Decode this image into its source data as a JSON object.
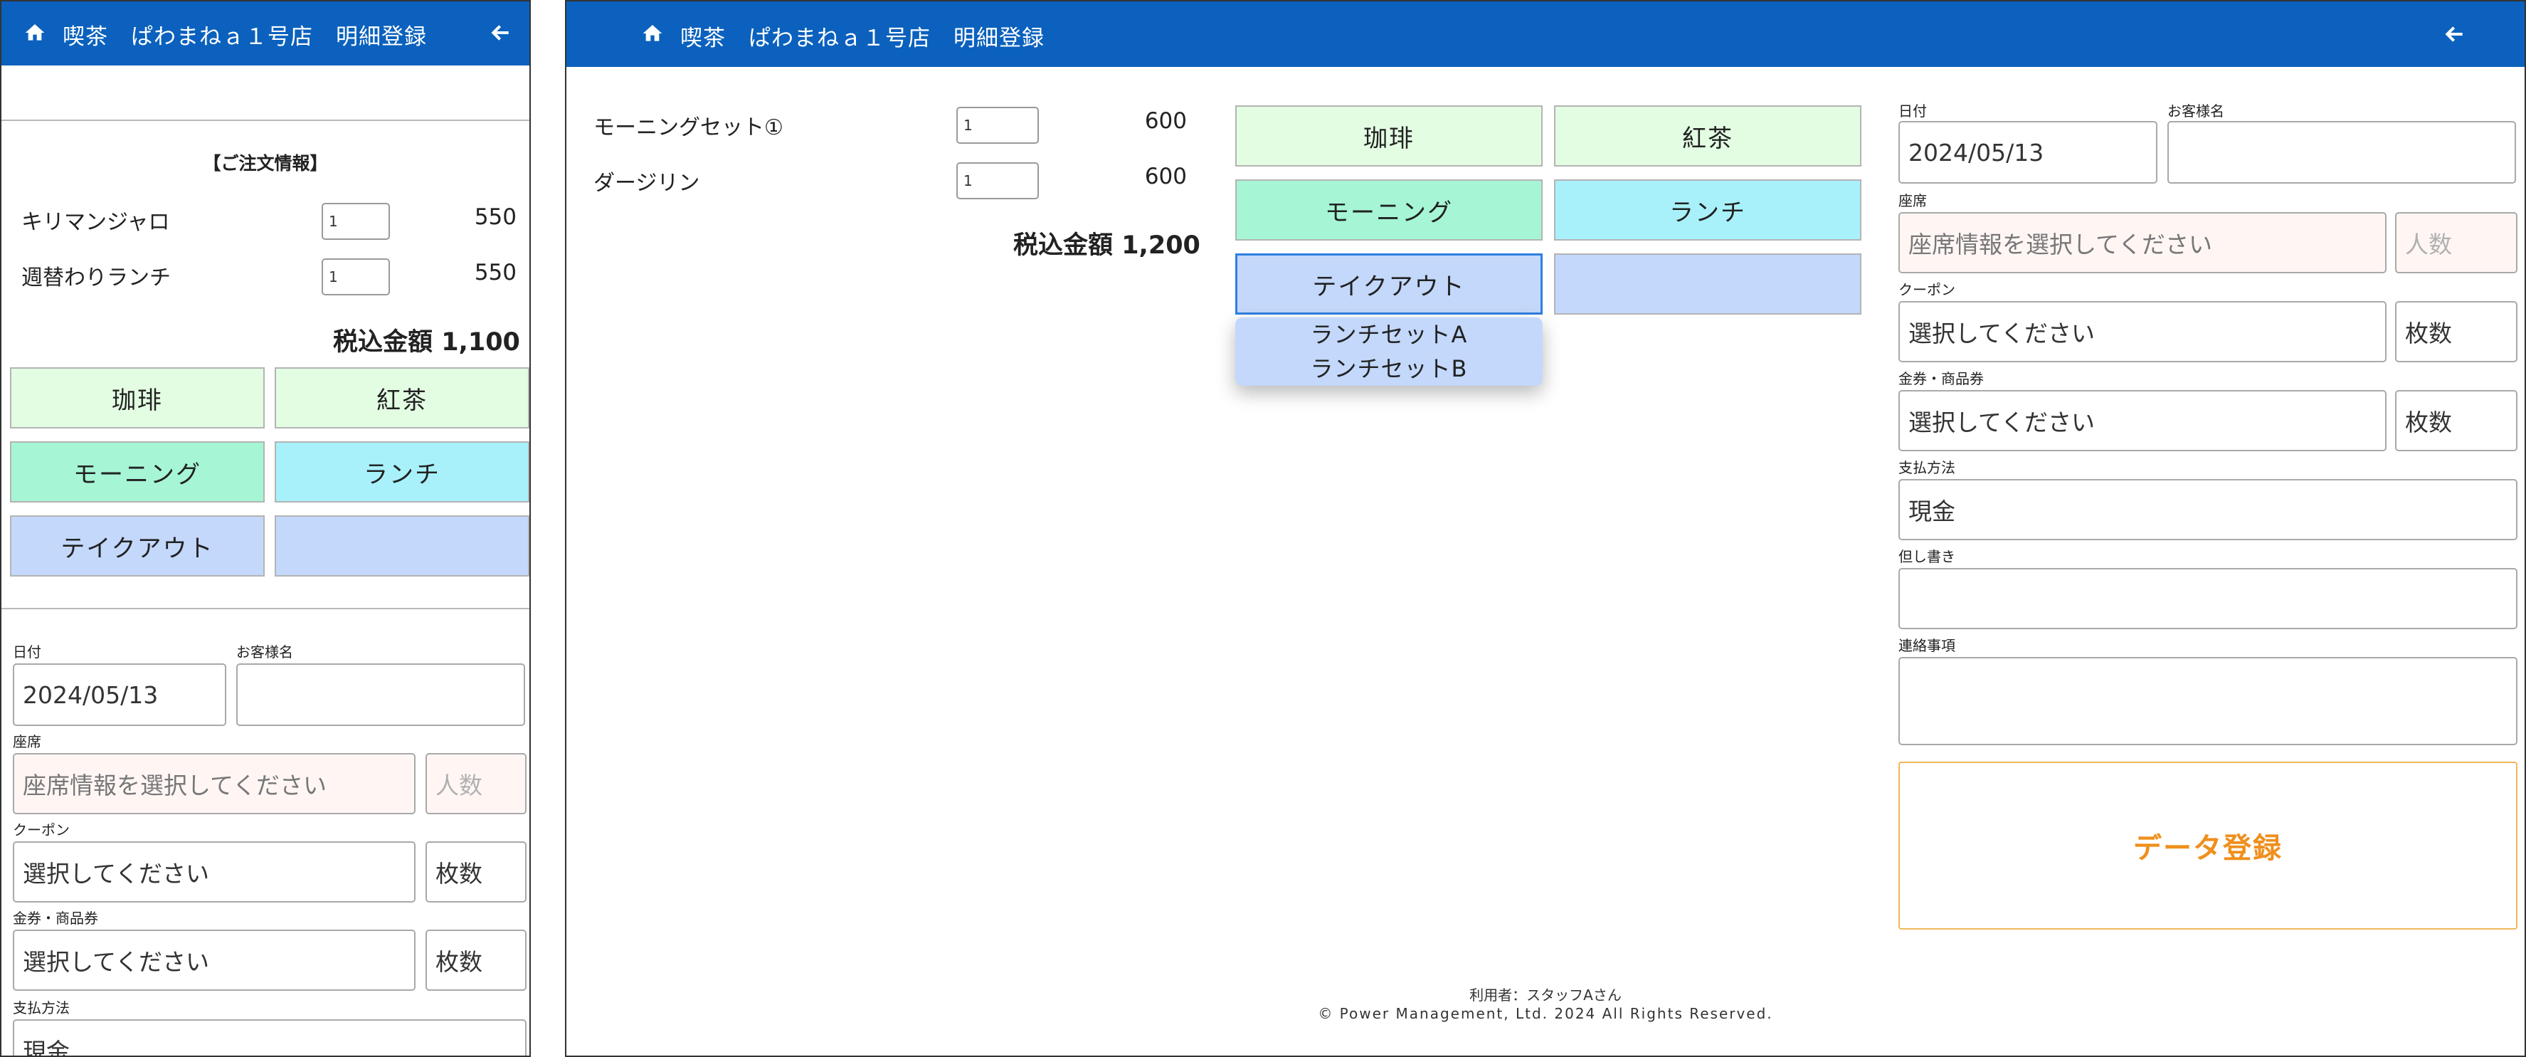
{
  "header": {
    "title": "喫茶　ぱわまねａ１号店　明細登録",
    "home_icon": "home-icon",
    "back_icon": "arrow-left-icon",
    "background": "#0b61bd"
  },
  "order_section": {
    "title": "【ご注文情報】"
  },
  "mobile_order": {
    "items": [
      {
        "name": "キリマンジャロ",
        "qty": "1",
        "price": "550"
      },
      {
        "name": "週替わりランチ",
        "qty": "1",
        "price": "550"
      }
    ],
    "total_label": "税込金額",
    "total_value": "1,100"
  },
  "desktop_order": {
    "items": [
      {
        "name": "モーニングセット①",
        "qty": "1",
        "price": "600"
      },
      {
        "name": "ダージリン",
        "qty": "1",
        "price": "600"
      }
    ],
    "total_label": "税込金額",
    "total_value": "1,200"
  },
  "categories": [
    {
      "label": "珈琲",
      "color": "#e3fde3"
    },
    {
      "label": "紅茶",
      "color": "#e3fde3"
    },
    {
      "label": "モーニング",
      "color": "#a6f6d6"
    },
    {
      "label": "ランチ",
      "color": "#a8f1fb"
    },
    {
      "label": "テイクアウト",
      "color": "#c3d8fb"
    },
    {
      "label": "",
      "color": "#c3d8fb"
    }
  ],
  "dropdown": {
    "items": [
      "ランチセットA",
      "ランチセットB"
    ]
  },
  "form": {
    "date_label": "日付",
    "date_value": "2024/05/13",
    "customer_label": "お客様名",
    "customer_value": "",
    "seat_label": "座席",
    "seat_placeholder": "座席情報を選択してください",
    "people_placeholder": "人数",
    "coupon_label": "クーポン",
    "coupon_placeholder": "選択してください",
    "coupon_count": "枚数",
    "voucher_label": "金券・商品券",
    "voucher_placeholder": "選択してください",
    "voucher_count": "枚数",
    "payment_label": "支払方法",
    "payment_value": "現金",
    "note_label": "但し書き",
    "note_value": "",
    "contact_label": "連絡事項",
    "contact_value": ""
  },
  "submit_label": "データ登録",
  "footer": {
    "user_line": "利用者：スタッフAさん",
    "copyright": "© Power Management, Ltd. 2024 All Rights Reserved."
  }
}
